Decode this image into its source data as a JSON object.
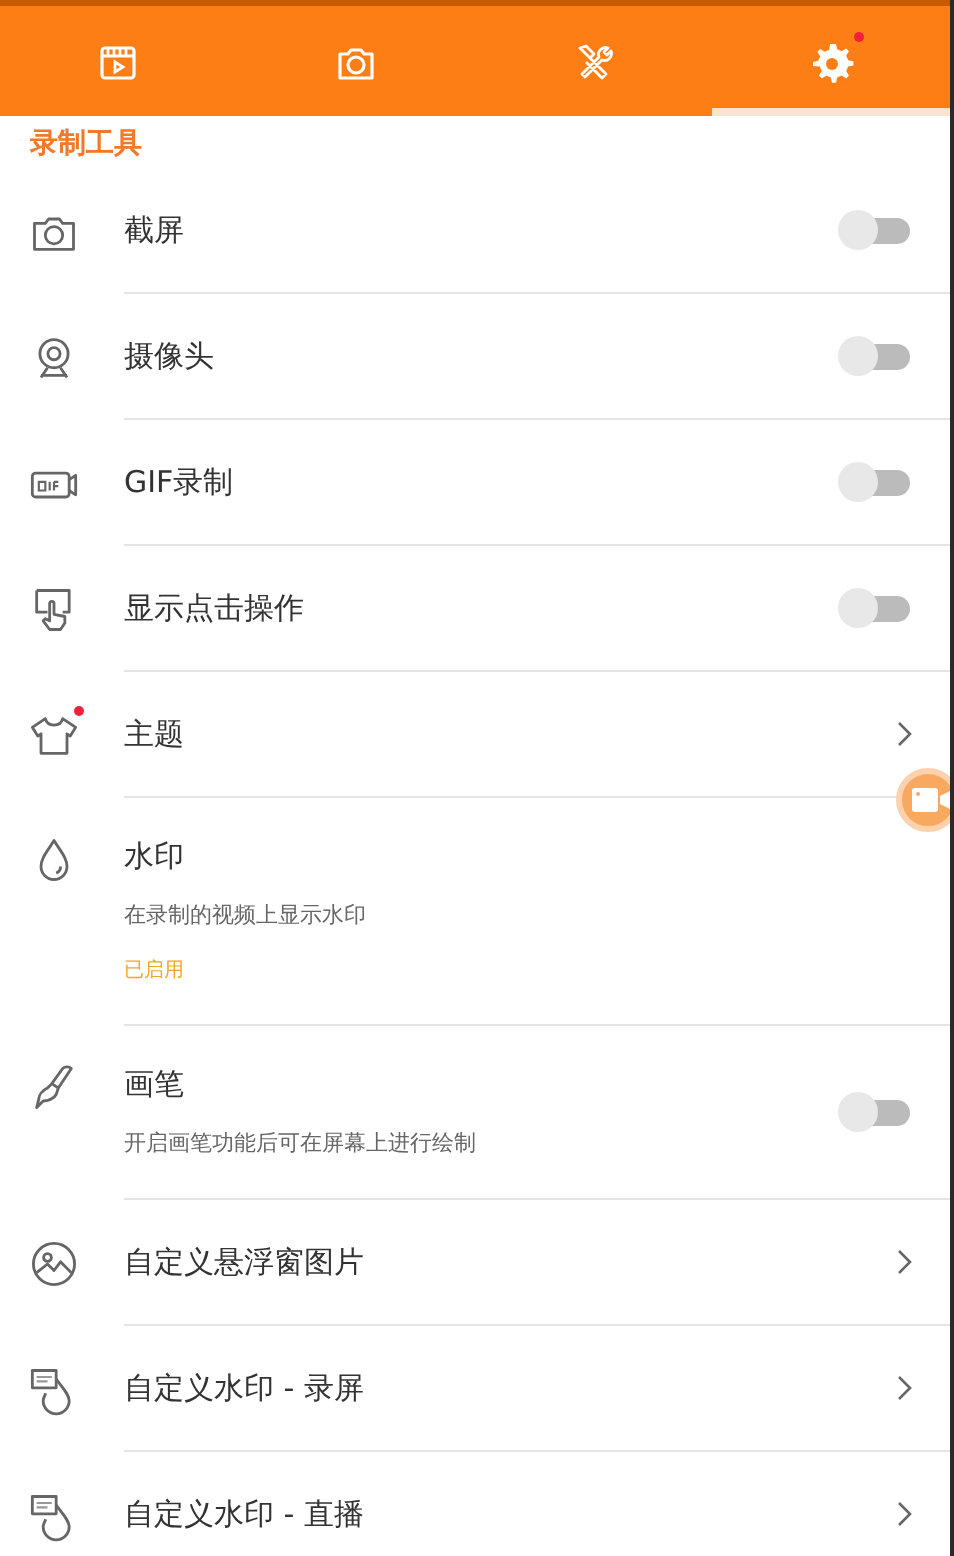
{
  "tabs": [
    {
      "selected": false,
      "badge": false
    },
    {
      "selected": false,
      "badge": false
    },
    {
      "selected": false,
      "badge": false
    },
    {
      "selected": true,
      "badge": true
    }
  ],
  "section": "录制工具",
  "items": [
    {
      "kind": "toggle",
      "title": "截屏",
      "on": false,
      "badge": false
    },
    {
      "kind": "toggle",
      "title": "摄像头",
      "on": false,
      "badge": false
    },
    {
      "kind": "toggle",
      "title": "GIF录制",
      "on": false,
      "badge": false
    },
    {
      "kind": "toggle",
      "title": "显示点击操作",
      "on": false,
      "badge": false
    },
    {
      "kind": "link",
      "title": "主题",
      "badge": true
    },
    {
      "kind": "info",
      "title": "水印",
      "subtitle": "在录制的视频上显示水印",
      "status": "已启用",
      "badge": false
    },
    {
      "kind": "toggle",
      "title": "画笔",
      "subtitle": "开启画笔功能后可在屏幕上进行绘制",
      "on": false,
      "badge": false
    },
    {
      "kind": "link",
      "title": "自定义悬浮窗图片",
      "badge": false
    },
    {
      "kind": "link",
      "title": "自定义水印 - 录屏",
      "badge": false
    },
    {
      "kind": "link",
      "title": "自定义水印 - 直播",
      "badge": false
    }
  ]
}
